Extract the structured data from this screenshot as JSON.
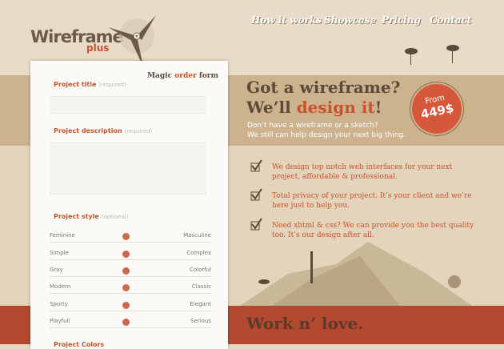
{
  "brand": {
    "name": "Wireframe",
    "suffix": "plus"
  },
  "nav": [
    {
      "label": "How it works"
    },
    {
      "label": "Showcase"
    },
    {
      "label": "Pricing"
    },
    {
      "label": "Contact"
    }
  ],
  "form": {
    "heading_a": "Magic ",
    "heading_b": "order",
    "heading_c": " form",
    "title_label": "Project title",
    "description_label": "Project description",
    "style_label": "Project style",
    "required": "(required)",
    "optional": "(optional)",
    "sliders": [
      {
        "left": "Feminine",
        "right": "Masculine",
        "value": 0.5
      },
      {
        "left": "Simple",
        "right": "Complex",
        "value": 0.5
      },
      {
        "left": "Gray",
        "right": "Colorful",
        "value": 0.5
      },
      {
        "left": "Modern",
        "right": "Classic",
        "value": 0.5
      },
      {
        "left": "Sporty",
        "right": "Elegant",
        "value": 0.5
      },
      {
        "left": "Playfull",
        "right": "Serious",
        "value": 0.5
      }
    ],
    "next_label": "Project Colors"
  },
  "hero": {
    "line1": "Got a wireframe?",
    "line2a": "We’ll ",
    "line2b": "design it",
    "line2c": "!",
    "sub1": "Don’t have a wireframe or a sketch?",
    "sub2": "We still can help design your next big thing."
  },
  "badge": {
    "from": "From",
    "price": "449$"
  },
  "features": [
    {
      "text": "We design top notch web interfaces for your next project, affordable & professional."
    },
    {
      "text": "Total privacy of your project. It’s your client and we’re here just to help you."
    },
    {
      "text": "Need xhtml & css? We can provide you the best quality too. It’s our design after all."
    }
  ],
  "footer": {
    "title": "Work n’ love."
  },
  "colors": {
    "accent": "#c9522d",
    "dark": "#5a4a3a",
    "tan": "#cdb38d",
    "red": "#b5492f"
  }
}
